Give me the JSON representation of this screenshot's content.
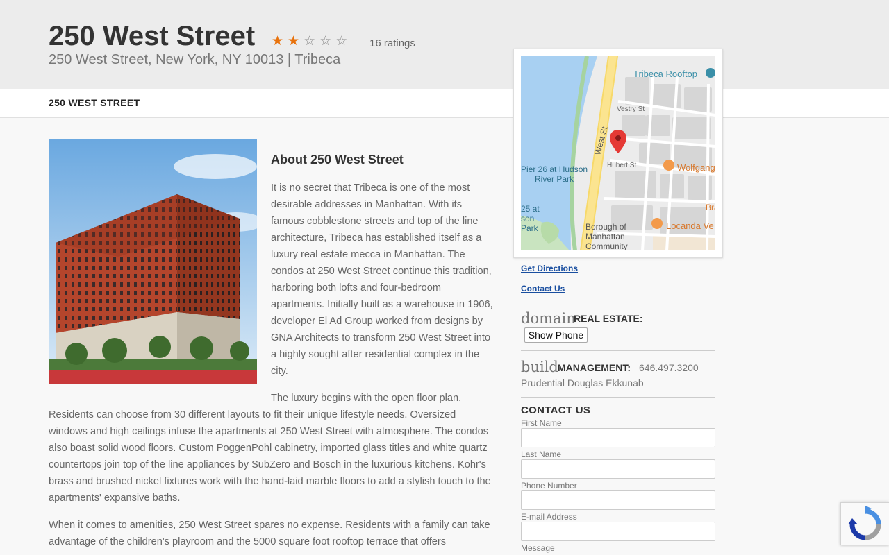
{
  "header": {
    "title": "250 West Street",
    "stars": {
      "filled": 2,
      "total": 5,
      "filled_glyph": "★",
      "empty_glyph": "☆",
      "filled_color": "#e8720c"
    },
    "ratings": "16 ratings",
    "subtitle": "250 West Street, New York, NY 10013 | Tribeca"
  },
  "nav": {
    "item": "250 WEST STREET"
  },
  "about": {
    "title": "About 250 West Street",
    "p1": "It is no secret that Tribeca is one of the most desirable addresses in Manhattan. With its famous cobblestone streets and top of the line architecture, Tribeca has established itself as a luxury real estate mecca in Manhattan. The condos at 250 West Street continue this tradition, harboring both lofts and four-bedroom apartments. Initially built as a warehouse in 1906, developer El Ad Group worked from designs by GNA Architects to transform 250 West Street into a highly sought after residential complex in the city.",
    "p2": "The luxury begins with the open floor plan. Residents can choose from 30 different layouts to fit their unique lifestyle needs. Oversized windows and high ceilings infuse the apartments at 250 West Street with atmosphere. The condos also boast solid wood floors. Custom PoggenPohl cabinetry, imported glass titles and white quartz countertops join top of the line appliances by SubZero and Bosch in the luxurious kitchens. Kohr's brass and brushed nickel fixtures work with the hand-laid marble floors to add a stylish touch to the apartments' expansive baths.",
    "p3": "When it comes to amenities, 250 West Street spares no expense. Residents with a family can take advantage of the children's playroom and the 5000 square foot rooftop terrace that offers"
  },
  "map": {
    "labels": {
      "rooftop": "Tribeca Rooftop",
      "vestry": "Vestry St",
      "west": "West St",
      "hubert": "Hubert St",
      "pier1": "Pier 26 at Hudson",
      "pier2": "River Park",
      "wolfgang": "Wolfgang",
      "bran": "Bran",
      "p25a": "25 at",
      "p25b": "son",
      "p25c": "Park",
      "borough1": "Borough of",
      "borough2": "Manhattan",
      "borough3": "Community",
      "locanda": "Locanda Ve"
    }
  },
  "sidebar": {
    "directions": "Get Directions",
    "contact_link": "Contact Us",
    "domain_word": "domain",
    "real_estate_label": "REAL ESTATE:",
    "show_phone": "Show Phone",
    "build_word": "build",
    "management_label": "MANAGEMENT:",
    "management_phone": "646.497.3200",
    "management_name": "Prudential Douglas Ekkunab"
  },
  "contact": {
    "title": "CONTACT US",
    "first_name": "First Name",
    "last_name": "Last Name",
    "phone": "Phone Number",
    "email": "E-mail Address",
    "message": "Message"
  }
}
